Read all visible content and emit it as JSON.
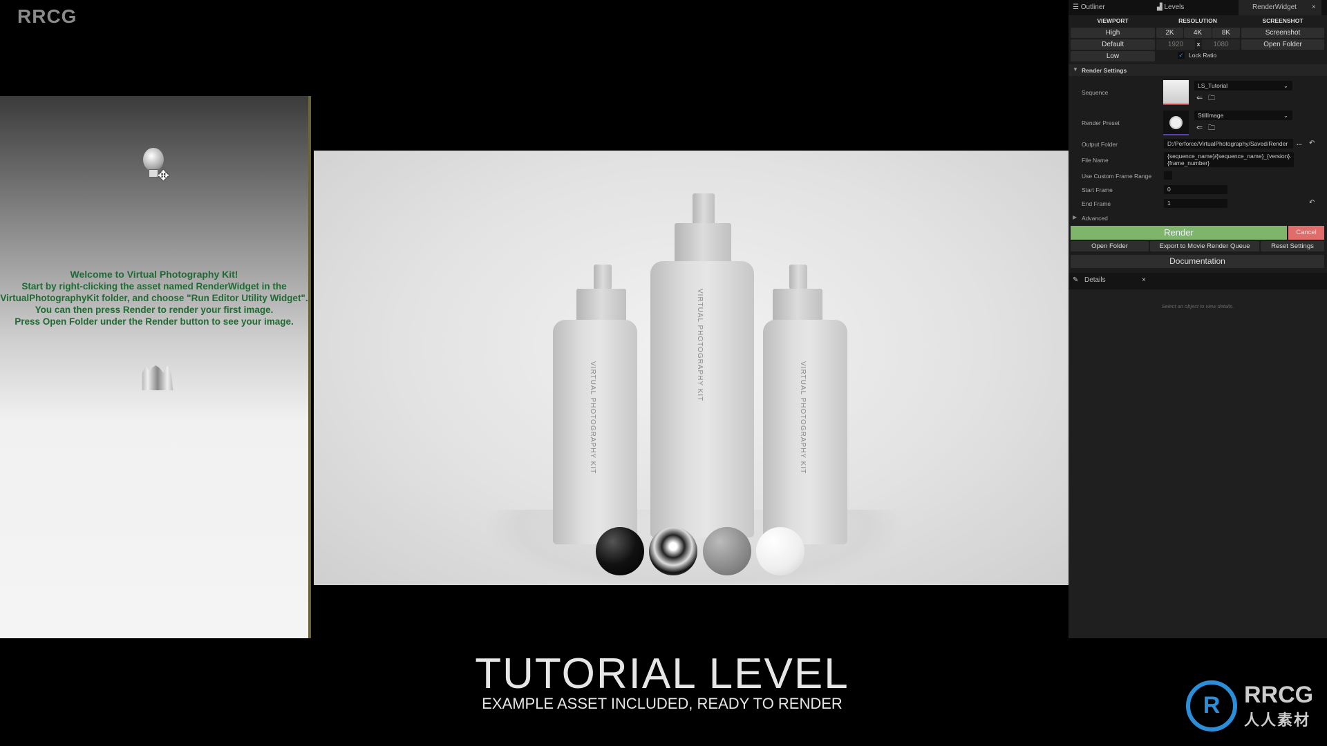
{
  "brand": "RRCG",
  "left_viewport": {
    "welcome_title": "Welcome to Virtual Photography Kit!",
    "lines": [
      "Start by right-clicking the asset named RenderWidget in the",
      "VirtualPhotographyKit folder, and choose \"Run Editor Utility Widget\".",
      "You can then press Render to render your first image.",
      "Press Open Folder under the Render button to see your image."
    ],
    "text_color": "#1f6b32"
  },
  "render_preview": {
    "bottle_label": "VIRTUAL PHOTOGRAPHY KIT"
  },
  "caption": {
    "title": "TUTORIAL LEVEL",
    "subtitle": "EXAMPLE ASSET INCLUDED, READY TO RENDER"
  },
  "logo": {
    "mark": "R",
    "line1": "RRCG",
    "line2": "人人素材",
    "color": "#2a8fd8"
  },
  "panel": {
    "tabs": [
      {
        "label": "Outliner",
        "icon": "list-icon"
      },
      {
        "label": "Levels",
        "icon": "levels-icon"
      },
      {
        "label": "RenderWidget",
        "active": true
      }
    ],
    "close": "×",
    "headers": {
      "viewport": "VIEWPORT",
      "resolution": "RESOLUTION",
      "screenshot": "SCREENSHOT"
    },
    "viewport_buttons": [
      "High",
      "Default",
      "Low"
    ],
    "resolution_buttons": [
      "2K",
      "4K",
      "8K"
    ],
    "width": "1920",
    "x": "x",
    "height": "1080",
    "lock_ratio": {
      "label": "Lock Ratio",
      "checked": true
    },
    "screenshot_buttons": [
      "Screenshot",
      "Open Folder"
    ],
    "render_settings": {
      "title": "Render Settings",
      "sequence_label": "Sequence",
      "sequence_value": "LS_Tutorial",
      "preset_label": "Render Preset",
      "preset_value": "StillImage",
      "output_label": "Output Folder",
      "output_value": "D:/Perforce/VirtualPhotography/Saved/Render",
      "browse": "...",
      "filename_label": "File Name",
      "filename_value": "{sequence_name}/{sequence_name}_{version}.{frame_number}",
      "custom_range_label": "Use Custom Frame Range",
      "custom_range_checked": false,
      "start_label": "Start Frame",
      "start_value": "0",
      "end_label": "End Frame",
      "end_value": "1",
      "advanced": "Advanced"
    },
    "render": "Render",
    "render_color": "#7fb56a",
    "cancel": "Cancel",
    "cancel_color": "#e06c6c",
    "open_folder": "Open Folder",
    "export": "Export to Movie Render Queue",
    "reset": "Reset Settings",
    "documentation": "Documentation",
    "details": {
      "title": "Details",
      "empty": "Select an object to view details."
    }
  }
}
